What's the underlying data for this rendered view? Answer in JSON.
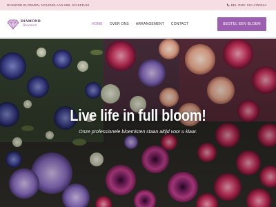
{
  "topbar": {
    "address": "DIAMOND BLOEMEN, NOLENSLAAN 69B, SCHIEDAM",
    "phone": "BEL ONS: 010-4750344"
  },
  "header": {
    "logo": {
      "name": "DIAMOND",
      "tagline": "Bloemen"
    },
    "nav": [
      {
        "label": "HOME",
        "active": true
      },
      {
        "label": "OVER ONS",
        "active": false
      },
      {
        "label": "ARRANGEMENT",
        "active": false
      },
      {
        "label": "CONTACT",
        "active": false
      }
    ],
    "cta_label": "BESTEL EEN BLOEM"
  },
  "hero": {
    "title": "Live life in full bloom!",
    "subtitle": "Onze professionele bloemisten staan altijd voor u klaar."
  },
  "colors": {
    "topbar_bg": "#f7dde4",
    "accent": "#9d5fb0",
    "nav_active": "#a25fb0"
  }
}
